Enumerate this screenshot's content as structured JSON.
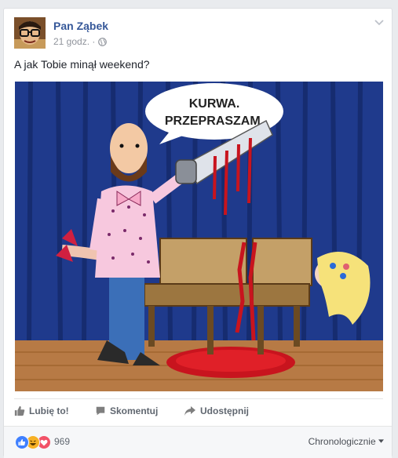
{
  "post": {
    "author": "Pan Ząbek",
    "time": "21 godz.",
    "separator": "·",
    "text": "A jak Tobie minął weekend?"
  },
  "comic": {
    "speech_line1": "KURWA.",
    "speech_line2": "PRZEPRASZAM."
  },
  "actions": {
    "like": "Lubię to!",
    "comment": "Skomentuj",
    "share": "Udostępnij"
  },
  "footer": {
    "reaction_count": "969",
    "sort": "Chronologicznie"
  },
  "colors": {
    "link": "#365899",
    "like_blue": "#4080ff",
    "haha_yellow": "#f7b125",
    "love_red": "#f25268"
  },
  "icons": {
    "like": "thumbs-up-icon",
    "comment": "comment-bubble-icon",
    "share": "share-arrow-icon",
    "privacy": "globe-icon",
    "menu": "chevron-down-icon"
  }
}
